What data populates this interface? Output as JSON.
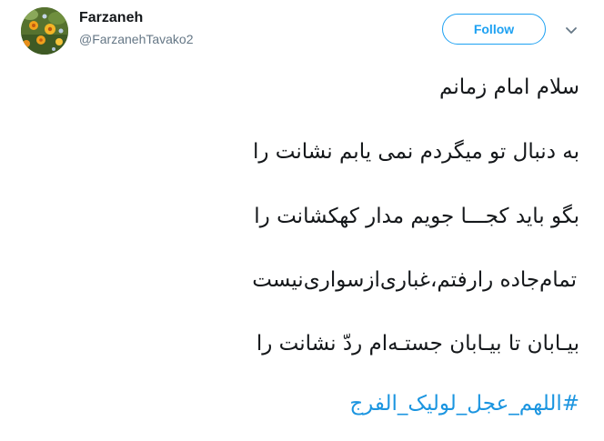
{
  "author": {
    "display_name": "Farzaneh",
    "handle": "@FarzanehTavako2"
  },
  "actions": {
    "follow_label": "Follow"
  },
  "tweet": {
    "lines": [
      "سلام امام زمانم",
      "به دنبال تو میگردم نمی یابم نشانت را",
      "بگو باید کجـــا جویم مدار کهکشانت را",
      "تمام‌جاده رارفتم،غبارى‌ازسوارى‌نيست",
      "بیـابان تا بیـابان جستـه‌ام ردّ نشانت را"
    ],
    "hashtag": "#اللهم_عجل_لولیک_الفرج"
  },
  "colors": {
    "accent": "#1da1f2",
    "hashtag": "#1b95e0",
    "text": "#14171a",
    "secondary": "#657786"
  },
  "icons": {
    "caret": "chevron-down-icon",
    "avatar": "flower-avatar-image"
  }
}
